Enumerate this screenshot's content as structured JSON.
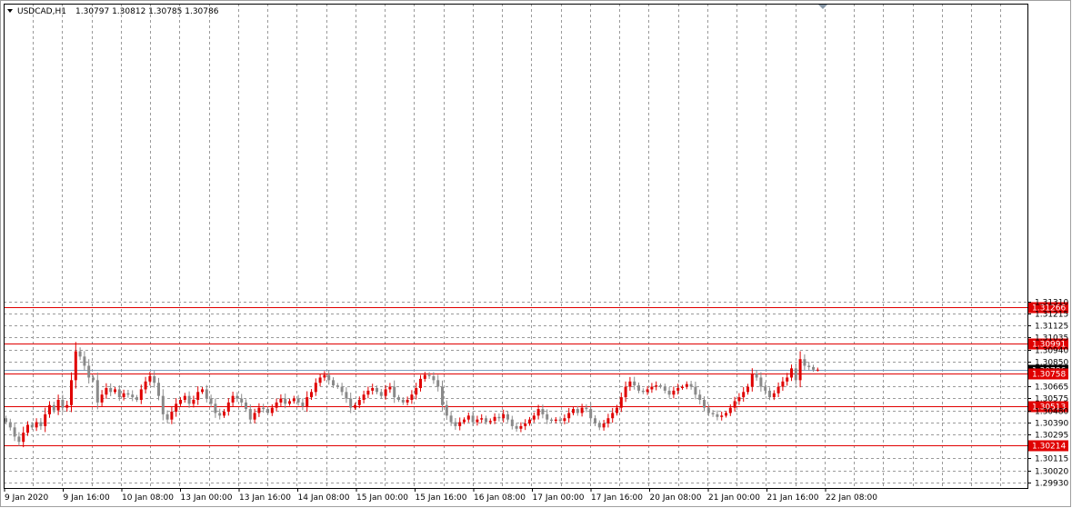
{
  "chart_header": {
    "symbol": "USDCAD,H1",
    "ohlc": "1.30797 1.30812 1.30785 1.30786"
  },
  "colors": {
    "bull": "#e00000",
    "bear": "#8a8a8a",
    "grid": "#9a9a9a",
    "level_line": "#e00000",
    "current_price_line": "#7f9fbf",
    "frame": "#000000"
  },
  "chart_data": {
    "type": "candlestick",
    "symbol": "USDCAD",
    "timeframe": "H1",
    "ylim": [
      1.2993,
      1.3135
    ],
    "y_ticks": [
      "1.31310",
      "1.31215",
      "1.31125",
      "1.31035",
      "1.30940",
      "1.30850",
      "1.30665",
      "1.30575",
      "1.30480",
      "1.30390",
      "1.30295",
      "1.30115",
      "1.30020",
      "1.29930"
    ],
    "x_ticks": [
      "9 Jan 2020",
      "9 Jan 16:00",
      "10 Jan 08:00",
      "13 Jan 00:00",
      "13 Jan 16:00",
      "14 Jan 08:00",
      "15 Jan 00:00",
      "15 Jan 16:00",
      "16 Jan 08:00",
      "17 Jan 00:00",
      "17 Jan 16:00",
      "20 Jan 08:00",
      "21 Jan 00:00",
      "21 Jan 16:00",
      "22 Jan 08:00"
    ],
    "horizontal_levels": [
      "1.31266",
      "1.30991",
      "1.30758",
      "1.30513",
      "1.30214"
    ],
    "current_price": "1.30786",
    "grid": true,
    "closes": [
      1.3039,
      1.3035,
      1.3028,
      1.3024,
      1.3031,
      1.3037,
      1.3035,
      1.3039,
      1.3036,
      1.3045,
      1.3052,
      1.3048,
      1.3056,
      1.305,
      1.3052,
      1.3071,
      1.3093,
      1.3089,
      1.3082,
      1.3073,
      1.3071,
      1.3054,
      1.306,
      1.3065,
      1.3062,
      1.3064,
      1.3058,
      1.3061,
      1.306,
      1.3058,
      1.3056,
      1.3064,
      1.307,
      1.3074,
      1.3069,
      1.3059,
      1.3045,
      1.3041,
      1.3047,
      1.3053,
      1.3056,
      1.3059,
      1.3053,
      1.3056,
      1.3062,
      1.3064,
      1.3057,
      1.3053,
      1.3046,
      1.3044,
      1.3047,
      1.3054,
      1.3059,
      1.3057,
      1.3054,
      1.3049,
      1.3041,
      1.3046,
      1.305,
      1.3049,
      1.3046,
      1.305,
      1.3054,
      1.3057,
      1.3053,
      1.3055,
      1.3057,
      1.3054,
      1.3051,
      1.3058,
      1.3062,
      1.3069,
      1.3073,
      1.3075,
      1.3071,
      1.3067,
      1.3066,
      1.3062,
      1.3057,
      1.305,
      1.3052,
      1.3056,
      1.306,
      1.3063,
      1.3065,
      1.3062,
      1.3059,
      1.3064,
      1.3066,
      1.3058,
      1.3056,
      1.3054,
      1.3056,
      1.306,
      1.3065,
      1.3072,
      1.3075,
      1.3074,
      1.3071,
      1.3066,
      1.3052,
      1.3044,
      1.3039,
      1.3036,
      1.3039,
      1.3041,
      1.3044,
      1.3039,
      1.3041,
      1.3042,
      1.3039,
      1.304,
      1.3043,
      1.3042,
      1.3045,
      1.3041,
      1.3036,
      1.3034,
      1.3036,
      1.3038,
      1.3041,
      1.3044,
      1.3049,
      1.3045,
      1.3041,
      1.304,
      1.3041,
      1.304,
      1.3042,
      1.3046,
      1.3049,
      1.3046,
      1.305,
      1.3049,
      1.3042,
      1.3038,
      1.3035,
      1.3038,
      1.3042,
      1.3046,
      1.305,
      1.3058,
      1.3066,
      1.307,
      1.3067,
      1.3063,
      1.3062,
      1.3064,
      1.3066,
      1.3067,
      1.3066,
      1.3063,
      1.306,
      1.3063,
      1.3065,
      1.3066,
      1.3068,
      1.3066,
      1.306,
      1.3056,
      1.305,
      1.3046,
      1.3045,
      1.3043,
      1.3044,
      1.3046,
      1.305,
      1.3055,
      1.3058,
      1.3062,
      1.3066,
      1.3076,
      1.3073,
      1.3066,
      1.3063,
      1.3058,
      1.3061,
      1.3066,
      1.307,
      1.3073,
      1.308,
      1.3071,
      1.3087,
      1.3082,
      1.3081,
      1.3079,
      1.3079
    ]
  }
}
